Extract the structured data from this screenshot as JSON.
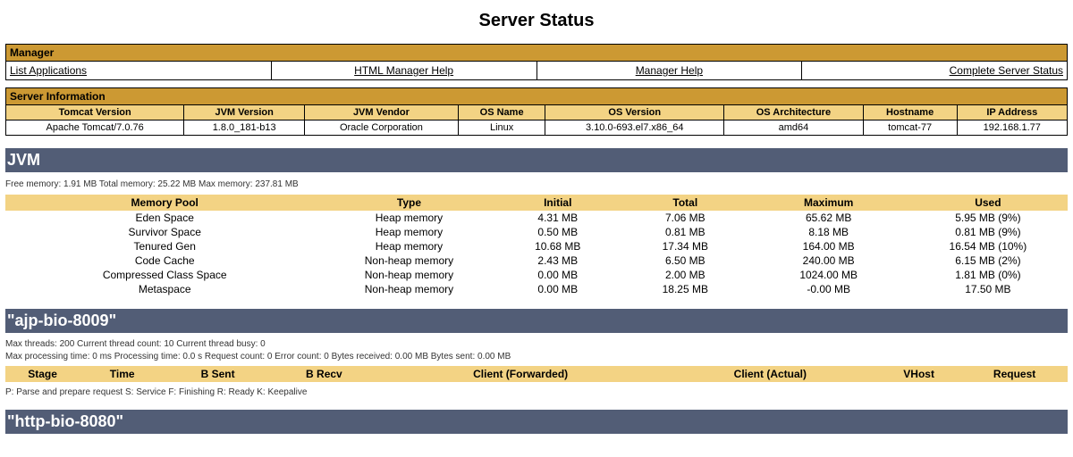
{
  "page_title": "Server Status",
  "manager": {
    "title": "Manager",
    "links": {
      "list_applications": "List Applications",
      "html_help": "HTML Manager Help",
      "manager_help": "Manager Help",
      "complete_status": "Complete Server Status"
    }
  },
  "server_info": {
    "title": "Server Information",
    "headers": {
      "tomcat_version": "Tomcat Version",
      "jvm_version": "JVM Version",
      "jvm_vendor": "JVM Vendor",
      "os_name": "OS Name",
      "os_version": "OS Version",
      "os_arch": "OS Architecture",
      "hostname": "Hostname",
      "ip": "IP Address"
    },
    "values": {
      "tomcat_version": "Apache Tomcat/7.0.76",
      "jvm_version": "1.8.0_181-b13",
      "jvm_vendor": "Oracle Corporation",
      "os_name": "Linux",
      "os_version": "3.10.0-693.el7.x86_64",
      "os_arch": "amd64",
      "hostname": "tomcat-77",
      "ip": "192.168.1.77"
    }
  },
  "jvm": {
    "title": "JVM",
    "summary": "Free memory: 1.91 MB Total memory: 25.22 MB Max memory: 237.81 MB",
    "headers": {
      "pool": "Memory Pool",
      "type": "Type",
      "initial": "Initial",
      "total": "Total",
      "max": "Maximum",
      "used": "Used"
    },
    "rows": [
      {
        "pool": "Eden Space",
        "type": "Heap memory",
        "initial": "4.31 MB",
        "total": "7.06 MB",
        "max": "65.62 MB",
        "used": "5.95 MB (9%)"
      },
      {
        "pool": "Survivor Space",
        "type": "Heap memory",
        "initial": "0.50 MB",
        "total": "0.81 MB",
        "max": "8.18 MB",
        "used": "0.81 MB (9%)"
      },
      {
        "pool": "Tenured Gen",
        "type": "Heap memory",
        "initial": "10.68 MB",
        "total": "17.34 MB",
        "max": "164.00 MB",
        "used": "16.54 MB (10%)"
      },
      {
        "pool": "Code Cache",
        "type": "Non-heap memory",
        "initial": "2.43 MB",
        "total": "6.50 MB",
        "max": "240.00 MB",
        "used": "6.15 MB (2%)"
      },
      {
        "pool": "Compressed Class Space",
        "type": "Non-heap memory",
        "initial": "0.00 MB",
        "total": "2.00 MB",
        "max": "1024.00 MB",
        "used": "1.81 MB (0%)"
      },
      {
        "pool": "Metaspace",
        "type": "Non-heap memory",
        "initial": "0.00 MB",
        "total": "18.25 MB",
        "max": "-0.00 MB",
        "used": "17.50 MB"
      }
    ]
  },
  "connector_ajp": {
    "title": "\"ajp-bio-8009\"",
    "stats_line1": "Max threads: 200 Current thread count: 10 Current thread busy: 0",
    "stats_line2": "Max processing time: 0 ms Processing time: 0.0 s Request count: 0 Error count: 0 Bytes received: 0.00 MB Bytes sent: 0.00 MB",
    "headers": {
      "stage": "Stage",
      "time": "Time",
      "bsent": "B Sent",
      "brecv": "B Recv",
      "client_fwd": "Client (Forwarded)",
      "client_act": "Client (Actual)",
      "vhost": "VHost",
      "request": "Request"
    },
    "legend": "P: Parse and prepare request S: Service F: Finishing R: Ready K: Keepalive"
  },
  "connector_http": {
    "title": "\"http-bio-8080\""
  }
}
